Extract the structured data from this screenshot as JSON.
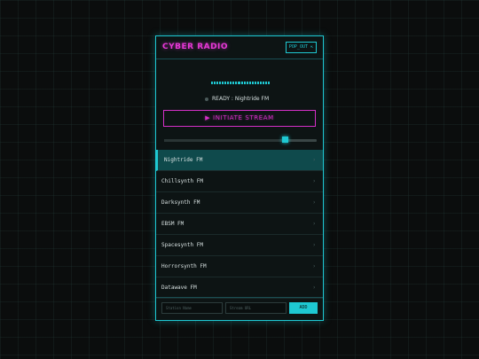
{
  "app": {
    "title": "CYBER RADIO",
    "popout_label": "POP_OUT ⇱"
  },
  "player": {
    "status_text": "READY : Nightride FM",
    "stream_button_label": "▶ INITIATE STREAM",
    "volume": 0.79,
    "visualizer_bars": 22
  },
  "stations": [
    {
      "name": "Nightride FM",
      "active": true
    },
    {
      "name": "Chillsynth FM",
      "active": false
    },
    {
      "name": "Darksynth FM",
      "active": false
    },
    {
      "name": "EBSM FM",
      "active": false
    },
    {
      "name": "Spacesynth FM",
      "active": false
    },
    {
      "name": "Horrorsynth FM",
      "active": false
    },
    {
      "name": "Datawave FM",
      "active": false
    }
  ],
  "station_chevron": "›",
  "add_form": {
    "name_placeholder": "Station Name",
    "url_placeholder": "Stream URL",
    "add_label": "ADD"
  },
  "colors": {
    "accent_cyan": "#1ec8d2",
    "accent_magenta": "#e838d8",
    "background": "#0b0d0d",
    "active_row": "#0f4a4c"
  },
  "icons": {
    "status": "status-dot-icon",
    "play": "play-icon",
    "chevron": "chevron-right-icon",
    "popout": "popout-icon"
  }
}
